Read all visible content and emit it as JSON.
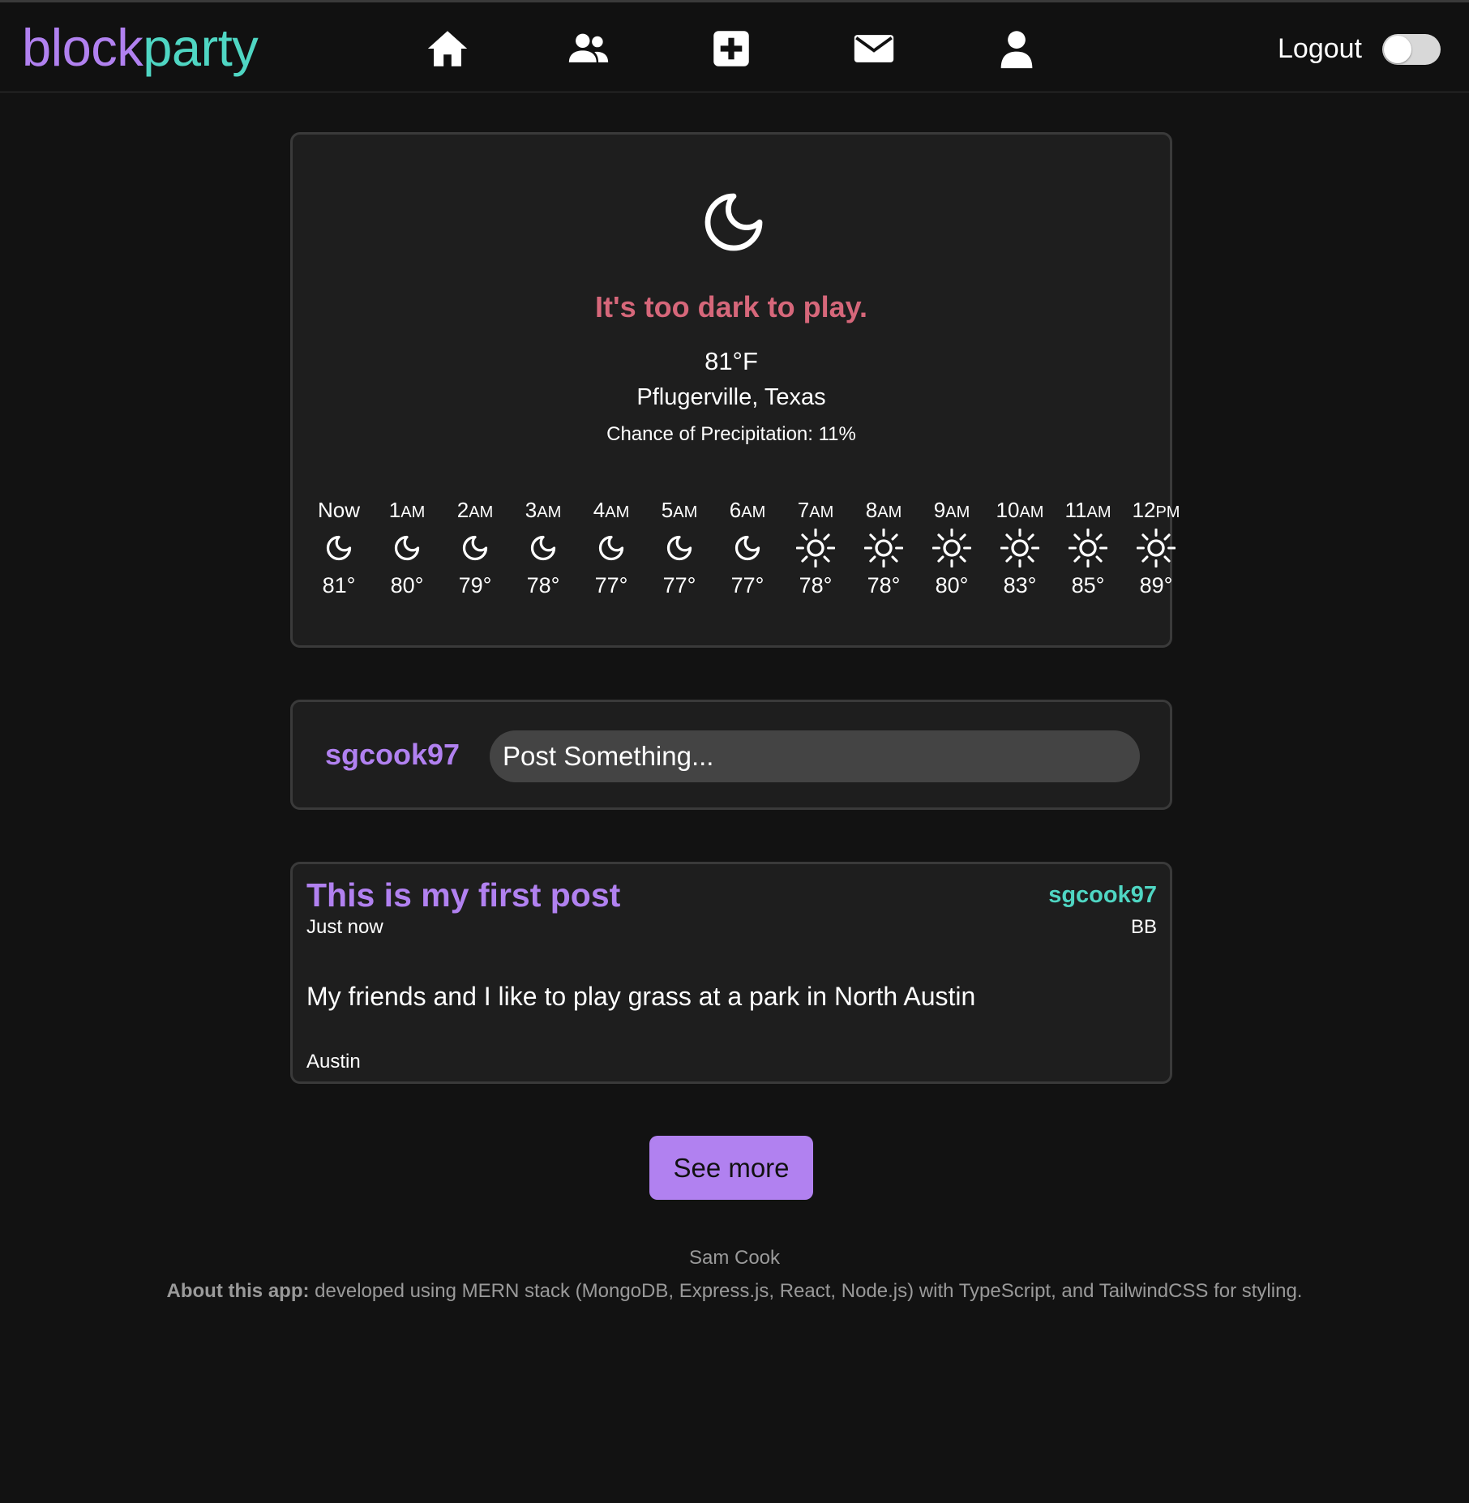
{
  "brand": {
    "part1": "block",
    "part2": "party",
    "color1": "#b181f0",
    "color2": "#4fd6c3"
  },
  "nav": {
    "icons": [
      "home-icon",
      "friends-icon",
      "create-post-icon",
      "messages-icon",
      "profile-icon"
    ],
    "logout_label": "Logout",
    "theme_toggle_on": false
  },
  "weather": {
    "current_icon": "moon-icon",
    "message": "It's too dark to play.",
    "message_color": "#d6677a",
    "temperature": "81°F",
    "location": "Pflugerville, Texas",
    "precipitation": "Chance of Precipitation: 11%",
    "hourly": [
      {
        "hour": "Now",
        "suffix": "",
        "icon": "moon",
        "temp": "81°"
      },
      {
        "hour": "1",
        "suffix": "AM",
        "icon": "moon",
        "temp": "80°"
      },
      {
        "hour": "2",
        "suffix": "AM",
        "icon": "moon",
        "temp": "79°"
      },
      {
        "hour": "3",
        "suffix": "AM",
        "icon": "moon",
        "temp": "78°"
      },
      {
        "hour": "4",
        "suffix": "AM",
        "icon": "moon",
        "temp": "77°"
      },
      {
        "hour": "5",
        "suffix": "AM",
        "icon": "moon",
        "temp": "77°"
      },
      {
        "hour": "6",
        "suffix": "AM",
        "icon": "moon",
        "temp": "77°"
      },
      {
        "hour": "7",
        "suffix": "AM",
        "icon": "sun",
        "temp": "78°"
      },
      {
        "hour": "8",
        "suffix": "AM",
        "icon": "sun",
        "temp": "78°"
      },
      {
        "hour": "9",
        "suffix": "AM",
        "icon": "sun",
        "temp": "80°"
      },
      {
        "hour": "10",
        "suffix": "AM",
        "icon": "sun",
        "temp": "83°"
      },
      {
        "hour": "11",
        "suffix": "AM",
        "icon": "sun",
        "temp": "85°"
      },
      {
        "hour": "12",
        "suffix": "PM",
        "icon": "sun",
        "temp": "89°"
      }
    ]
  },
  "composer": {
    "username": "sgcook97",
    "placeholder": "Post Something..."
  },
  "post": {
    "title": "This is my first post",
    "time": "Just now",
    "username": "sgcook97",
    "sport": "BB",
    "body": "My friends and I like to play grass at a park in North Austin",
    "city": "Austin"
  },
  "see_more_label": "See more",
  "footer": {
    "author": "Sam Cook",
    "about_label": "About this app:",
    "about_text": " developed using MERN stack (MongoDB, Express.js, React, Node.js) with TypeScript, and TailwindCSS for styling."
  }
}
